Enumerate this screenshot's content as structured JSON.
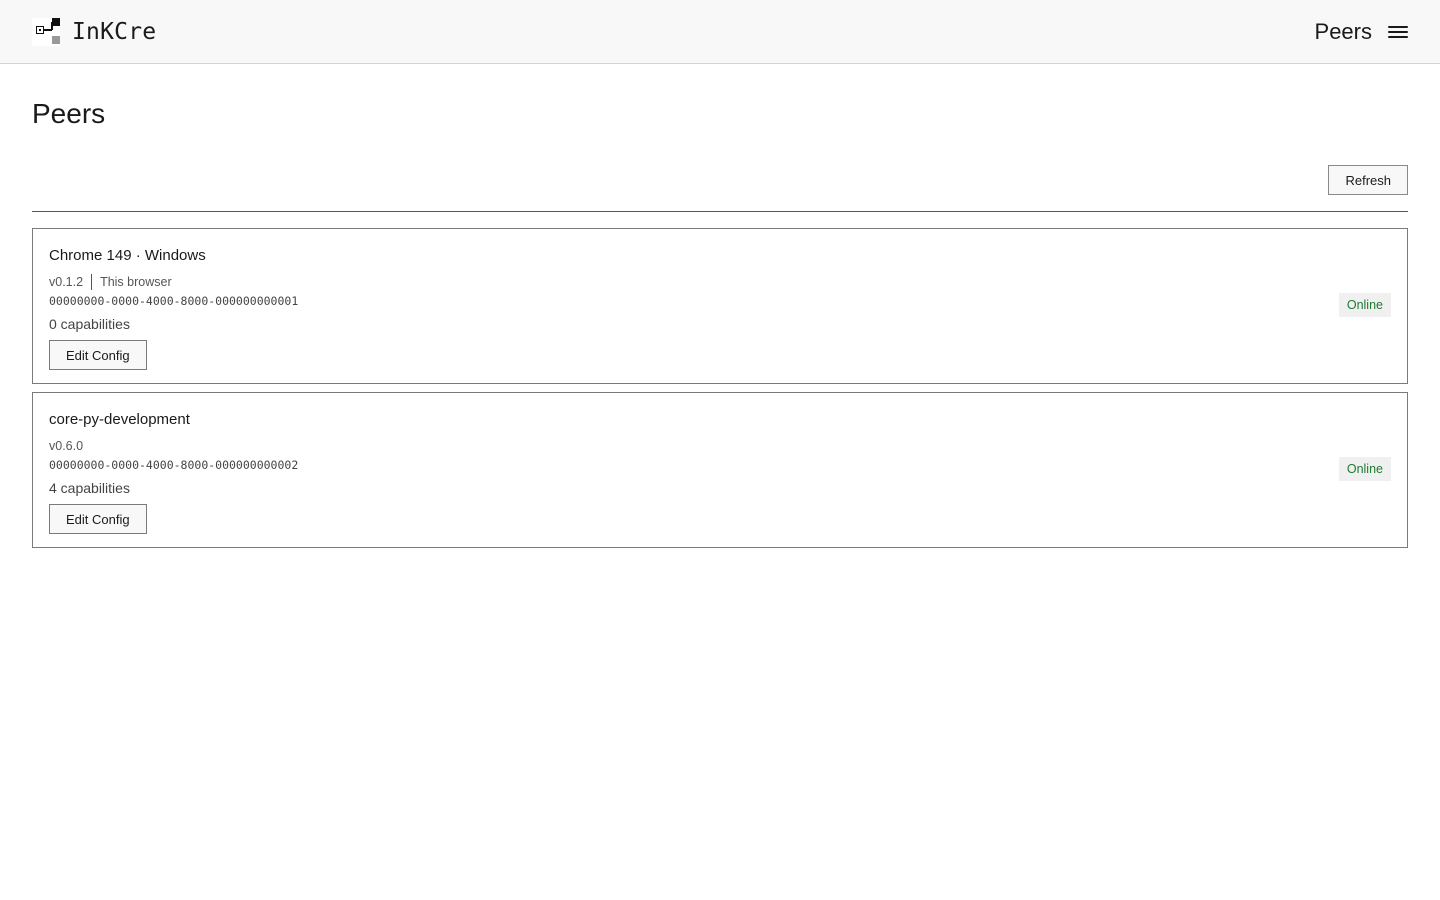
{
  "header": {
    "brand_name": "InKCre",
    "nav_title": "Peers",
    "menu_icon": "hamburger-menu-icon",
    "logo_icon": "inkcre-logo-icon"
  },
  "page": {
    "title": "Peers",
    "refresh_label": "Refresh"
  },
  "peers": [
    {
      "name": "Chrome 149 · Windows",
      "version": "v0.1.2",
      "tag": "This browser",
      "id": "00000000-0000-4000-8000-000000000001",
      "capabilities": "0 capabilities",
      "edit_label": "Edit Config",
      "status": "Online"
    },
    {
      "name": "core-py-development",
      "version": "v0.6.0",
      "tag": "",
      "id": "00000000-0000-4000-8000-000000000002",
      "capabilities": "4 capabilities",
      "edit_label": "Edit Config",
      "status": "Online"
    }
  ],
  "colors": {
    "status_online": "#1f7a34",
    "topbar_bg": "#f8f8f8"
  }
}
